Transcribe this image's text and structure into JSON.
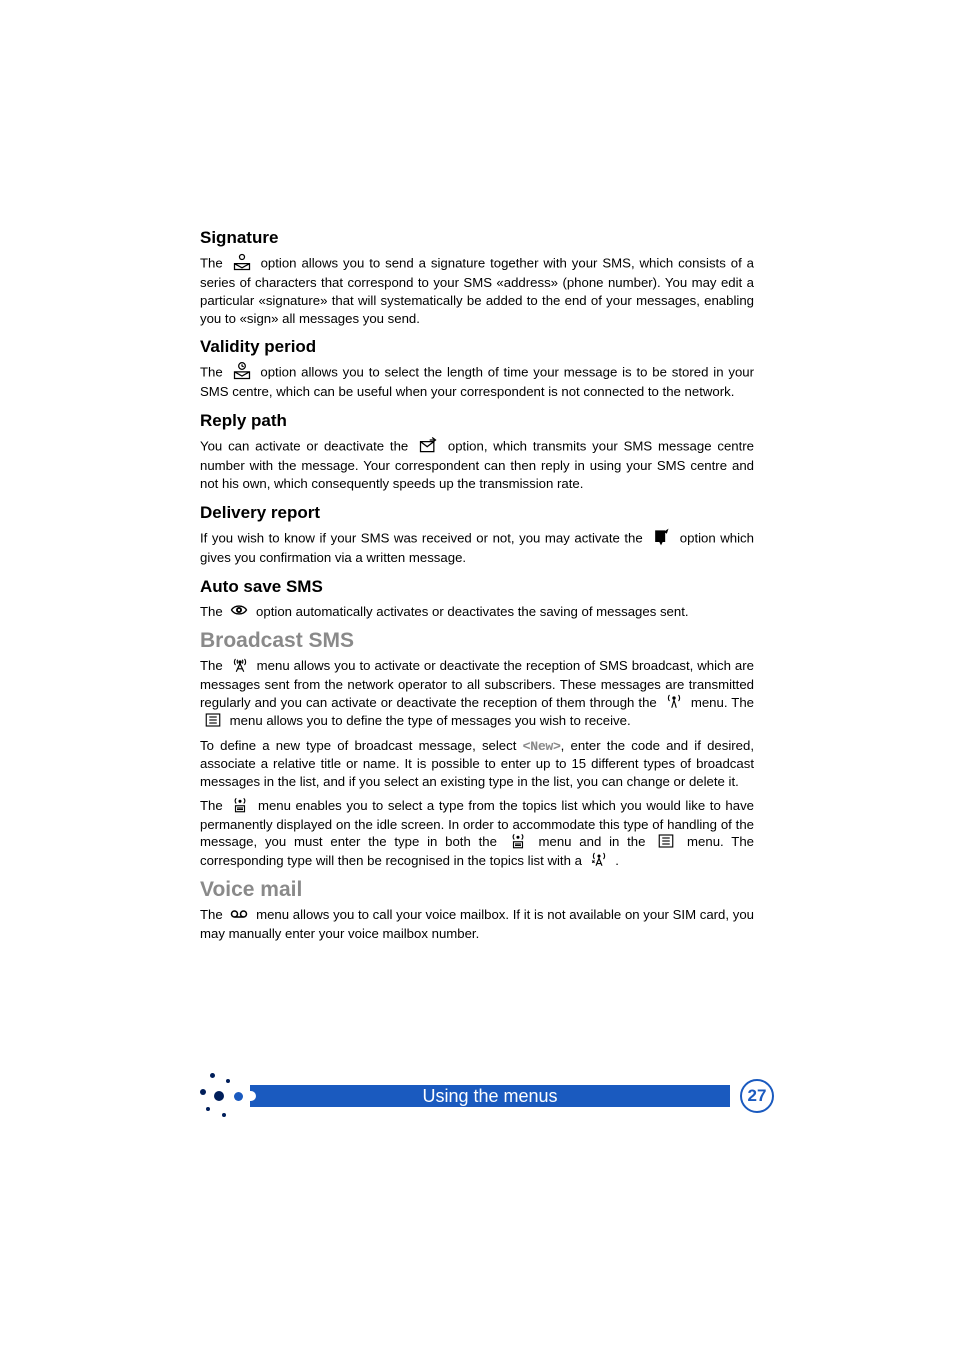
{
  "sections": {
    "signature": {
      "heading": "Signature",
      "p1a": "The ",
      "p1b": " option allows you to send a signature together with your SMS, which consists of a series of characters that correspond to your  SMS «address» (phone number).  You may edit a particular «signature» that will systematically be added to the end of your messages, enabling you to «sign» all messages you send."
    },
    "validity": {
      "heading": "Validity period",
      "p1a": "The ",
      "p1b": " option allows you to select the length of time your message is to be stored in your SMS centre, which can be useful when your correspondent is not connected to the network."
    },
    "reply": {
      "heading": "Reply path",
      "p1a": "You can activate or deactivate the ",
      "p1b": " option, which transmits your SMS message centre number with the message.  Your correspondent can then reply in using your SMS centre and not his own, which consequently speeds up the transmission rate."
    },
    "delivery": {
      "heading": "Delivery report",
      "p1a": "If you wish to know if your SMS was received or not, you may activate the ",
      "p1b": " option which gives you confirmation via a written message."
    },
    "autosave": {
      "heading": "Auto save SMS",
      "p1a": "The ",
      "p1b": " option automatically activates or deactivates the saving of messages sent."
    },
    "broadcast": {
      "heading": "Broadcast SMS",
      "p1a": "The ",
      "p1b": " menu allows you to activate or deactivate the reception of SMS broadcast, which are messages sent from the network operator to all subscribers.  These messages are transmitted regularly and you can activate or deactivate the reception of them through the ",
      "p1c": " menu.  The ",
      "p1d": " menu allows you to define the type of messages you wish to receive.",
      "p2a": "To define a new type of broadcast message, select ",
      "new_label": "<New>",
      "p2b": ", enter the code and if desired, associate a relative title or name.  It is possible to enter up to 15 different types of broadcast messages in the list, and if you select an existing type in the list, you can change or delete it.",
      "p3a": "The ",
      "p3b": " menu enables you to select a type from the topics list which you would like to have permanently displayed on the idle screen.  In order to accommodate this type of handling of the message, you must enter the type in both the ",
      "p3c": " menu and in the ",
      "p3d": " menu.  The corresponding type will then be recognised in the topics list with a ",
      "p3e": " ."
    },
    "voicemail": {
      "heading": "Voice mail",
      "p1a": "The ",
      "p1b": " menu allows you to call your voice mailbox.  If it is not available on your SIM card, you may manually enter your voice mailbox number."
    }
  },
  "footer": {
    "title": "Using the menus",
    "page": "27"
  }
}
